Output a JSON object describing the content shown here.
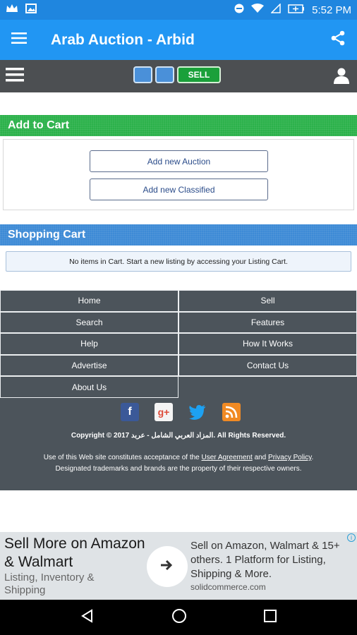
{
  "status": {
    "time": "5:52 PM"
  },
  "appbar": {
    "title": "Arab Auction - Arbid"
  },
  "sitenav": {
    "sell_label": "SELL"
  },
  "add_to_cart": {
    "heading": "Add to Cart",
    "buttons": [
      "Add new Auction",
      "Add new Classified"
    ]
  },
  "shopping_cart": {
    "heading": "Shopping Cart",
    "notice": "No items in Cart. Start a new listing by accessing your Listing Cart."
  },
  "footer": {
    "links": [
      [
        "Home",
        "Sell"
      ],
      [
        "Search",
        "Features"
      ],
      [
        "Help",
        "How It Works"
      ],
      [
        "Advertise",
        "Contact Us"
      ],
      [
        "About Us",
        ""
      ]
    ],
    "copyright": "Copyright © 2017 المزاد العربي الشامل - عربد. All Rights Reserved.",
    "legal_prefix": "Use of this Web site constitutes acceptance of the",
    "user_agreement": "User Agreement",
    "and": "and",
    "privacy_policy": "Privacy Policy",
    "legal_line2": "Designated trademarks and brands are the property of their respective owners."
  },
  "ad": {
    "headline": "Sell More on Amazon & Walmart",
    "subline": "Listing, Inventory & Shipping",
    "body": "Sell on Amazon, Walmart & 15+ others. 1 Platform for Listing, Shipping & More.",
    "url": "solidcommerce.com"
  },
  "colors": {
    "appbar": "#2196f3",
    "green_header": "#2bb14a",
    "blue_header": "#3d8ad6",
    "footer": "#4c545b"
  }
}
